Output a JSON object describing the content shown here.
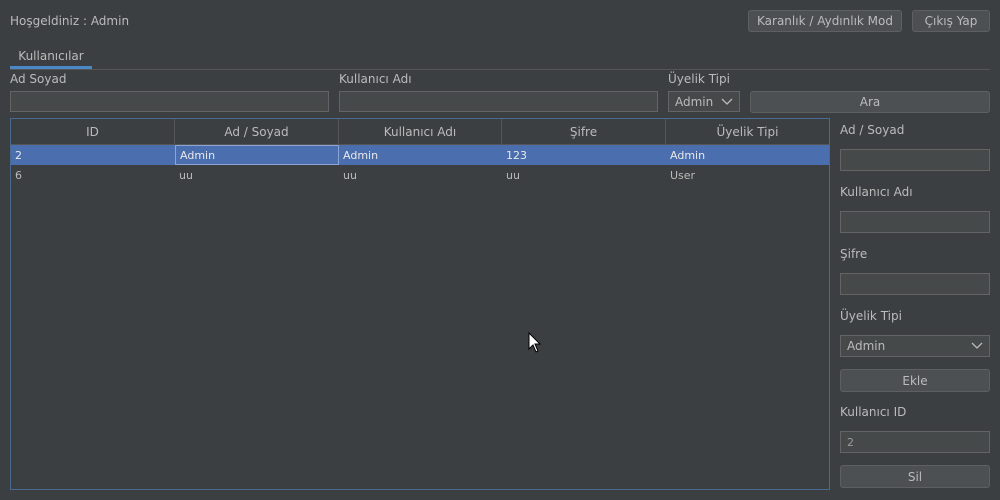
{
  "header": {
    "welcome": "Hoşgeldiniz : Admin",
    "theme_button": "Karanlık / Aydınlık Mod",
    "logout_button": "Çıkış Yap"
  },
  "tabs": [
    {
      "label": "Kullanıcılar",
      "selected": true
    }
  ],
  "search": {
    "name_label": "Ad Soyad",
    "name_value": "",
    "username_label": "Kullanıcı Adı",
    "username_value": "",
    "type_label": "Üyelik Tipi",
    "type_selected": "Admin",
    "search_button": "Ara"
  },
  "table": {
    "columns": [
      "ID",
      "Ad / Soyad",
      "Kullanıcı Adı",
      "Şifre",
      "Üyelik Tipi"
    ],
    "rows": [
      {
        "id": "2",
        "name": "Admin",
        "username": "Admin",
        "password": "123",
        "type": "Admin",
        "selected": true
      },
      {
        "id": "6",
        "name": "uu",
        "username": "uu",
        "password": "uu",
        "type": "User",
        "selected": false
      }
    ]
  },
  "form": {
    "name_label": "Ad / Soyad",
    "name_value": "",
    "username_label": "Kullanıcı Adı",
    "username_value": "",
    "password_label": "Şifre",
    "password_value": "",
    "type_label": "Üyelik Tipi",
    "type_selected": "Admin",
    "add_button": "Ekle",
    "id_label": "Kullanıcı ID",
    "id_value": "2",
    "delete_button": "Sil"
  },
  "colors": {
    "background": "#3c3f41",
    "selection": "#4b6eaf",
    "tab_accent": "#4a88c7"
  }
}
